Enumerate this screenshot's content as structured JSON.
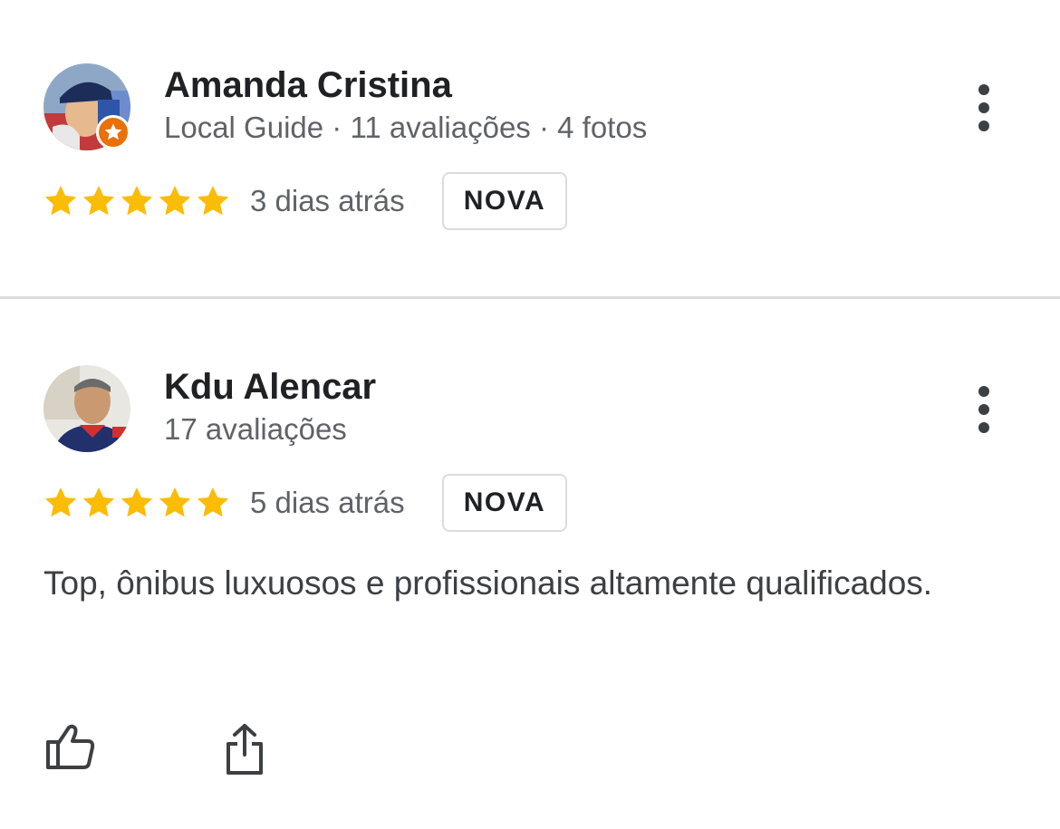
{
  "reviews": [
    {
      "name": "Amanda Cristina",
      "meta": "Local Guide · 11 avaliações · 4 fotos",
      "is_local_guide": true,
      "rating": 5,
      "date": "3 dias atrás",
      "badge": "NOVA",
      "text": ""
    },
    {
      "name": "Kdu Alencar",
      "meta": "17 avaliações",
      "is_local_guide": false,
      "rating": 5,
      "date": "5 dias atrás",
      "badge": "NOVA",
      "text": "Top, ônibus luxuosos e profissionais altamente qualificados."
    }
  ],
  "icons": {
    "menu": "more-vert-icon",
    "star": "star-icon",
    "like": "thumb-up-icon",
    "share": "share-icon",
    "guide_badge": "local-guide-star-icon"
  },
  "colors": {
    "star": "#fbbc04",
    "guide_badge": "#e8710a",
    "divider": "#dadce0"
  }
}
